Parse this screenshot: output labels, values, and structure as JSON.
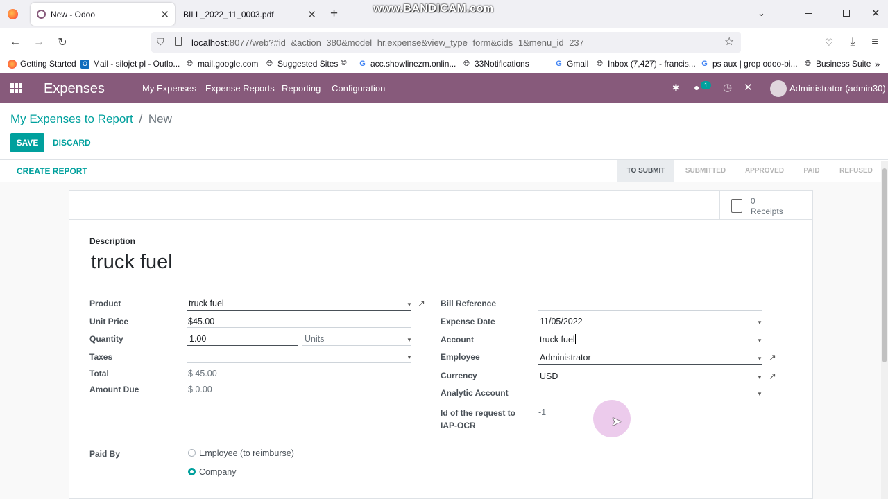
{
  "browser": {
    "tabs": [
      {
        "title": "New - Odoo"
      },
      {
        "title": "BILL_2022_11_0003.pdf"
      }
    ],
    "url_host": "localhost",
    "url_rest": ":8077/web?#id=&action=380&model=hr.expense&view_type=form&cids=1&menu_id=237",
    "watermark": "www.BANDICAM.com",
    "bookmarks": [
      {
        "label": "Getting Started",
        "icon": "firefox-icon"
      },
      {
        "label": "Mail - silojet pl - Outlo...",
        "icon": "outlook-icon"
      },
      {
        "label": "mail.google.com",
        "icon": "globe-icon"
      },
      {
        "label": "Suggested Sites",
        "icon": "globe-icon"
      },
      {
        "label": "",
        "icon": "globe-icon"
      },
      {
        "label": "acc.showlinezm.onlin...",
        "icon": "google-icon"
      },
      {
        "label": "33Notifications",
        "icon": "globe-icon"
      },
      {
        "label": "Gmail",
        "icon": "google-icon"
      },
      {
        "label": "Inbox (7,427) - francis...",
        "icon": "globe-icon"
      },
      {
        "label": "ps aux | grep odoo-bi...",
        "icon": "google-icon"
      },
      {
        "label": "Business Suite",
        "icon": "globe-icon"
      }
    ]
  },
  "odoo": {
    "app_name": "Expenses",
    "menu": [
      "My Expenses",
      "Expense Reports",
      "Reporting",
      "Configuration"
    ],
    "chat_badge": "1",
    "user": "Administrator (admin30)",
    "accent": "#875a7b",
    "primary": "#00a09d"
  },
  "control": {
    "breadcrumb_parent": "My Expenses to Report",
    "breadcrumb_sep": "/",
    "breadcrumb_current": "New",
    "save": "SAVE",
    "discard": "DISCARD"
  },
  "statusbar": {
    "create_report": "CREATE REPORT",
    "stages": [
      "TO SUBMIT",
      "SUBMITTED",
      "APPROVED",
      "PAID",
      "REFUSED"
    ],
    "active_stage": "TO SUBMIT"
  },
  "form": {
    "receipts_count": "0",
    "receipts_label": "Receipts",
    "description_label": "Description",
    "description": "truck fuel",
    "left": {
      "product_label": "Product",
      "product": "truck fuel",
      "unit_price_label": "Unit Price",
      "unit_price": "$45.00",
      "quantity_label": "Quantity",
      "quantity": "1.00",
      "uom_placeholder": "Units",
      "taxes_label": "Taxes",
      "total_label": "Total",
      "total": "$ 45.00",
      "amount_due_label": "Amount Due",
      "amount_due": "$ 0.00"
    },
    "right": {
      "bill_ref_label": "Bill Reference",
      "expense_date_label": "Expense Date",
      "expense_date": "11/05/2022",
      "account_label": "Account",
      "account": "truck fuel",
      "employee_label": "Employee",
      "employee": "Administrator",
      "currency_label": "Currency",
      "currency": "USD",
      "analytic_label": "Analytic Account",
      "iap_label_1": "Id of the request to",
      "iap_label_2": "IAP-OCR",
      "iap_value": "-1"
    },
    "paid_by_label": "Paid By",
    "paid_by_options": [
      "Employee (to reimburse)",
      "Company"
    ],
    "paid_by_selected": "Company"
  }
}
